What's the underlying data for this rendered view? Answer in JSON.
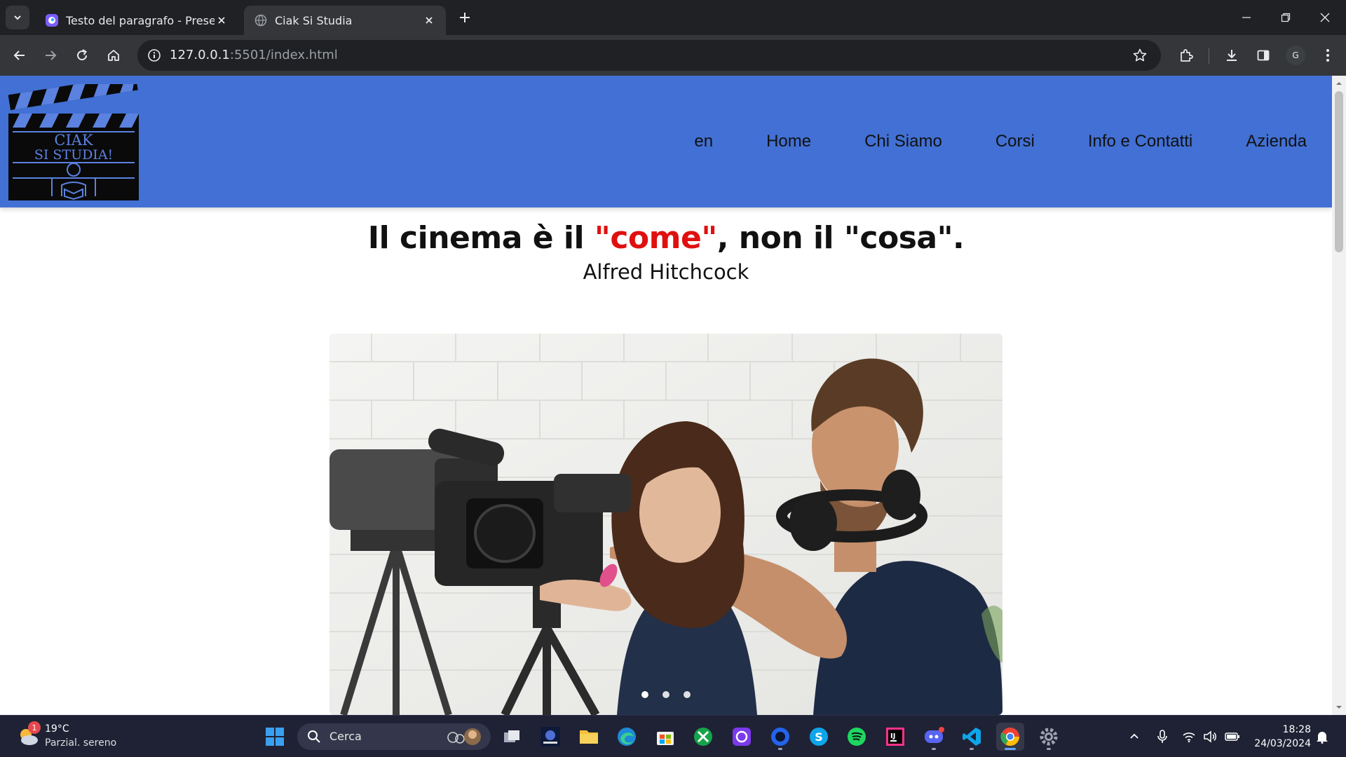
{
  "browser": {
    "tabs": [
      {
        "title": "Testo del paragrafo - Presentazione",
        "active": false
      },
      {
        "title": "Ciak Si Studia",
        "active": true
      }
    ],
    "address": {
      "host": "127.0.0.1",
      "port_path": ":5501/index.html"
    }
  },
  "site": {
    "logo_text_line1": "CIAK",
    "logo_text_line2": "SI STUDIA!",
    "nav": [
      "en",
      "Home",
      "Chi Siamo",
      "Corsi",
      "Info e Contatti",
      "Azienda"
    ],
    "quote": {
      "part1": "Il cinema è il ",
      "highlight": "\"come\"",
      "part2": ", non il \"cosa\".",
      "author": "Alfred Hitchcock"
    },
    "carousel": {
      "slides": 3,
      "active_index": 0
    },
    "colors": {
      "header_bg": "#4270d4",
      "highlight": "#e01010"
    }
  },
  "taskbar": {
    "weather": {
      "temp": "19°C",
      "desc": "Parzial. sereno",
      "badge": "1"
    },
    "search_placeholder": "Cerca",
    "time": "18:28",
    "date": "24/03/2024",
    "apps": [
      "start-icon",
      "search",
      "task-view-icon",
      "app-icon",
      "file-explorer-icon",
      "edge-icon",
      "store-icon",
      "xbox-icon",
      "app-icon",
      "app-icon",
      "skype-icon",
      "spotify-icon",
      "intellij-icon",
      "discord-icon",
      "vscode-icon",
      "chrome-icon",
      "settings-icon"
    ]
  }
}
